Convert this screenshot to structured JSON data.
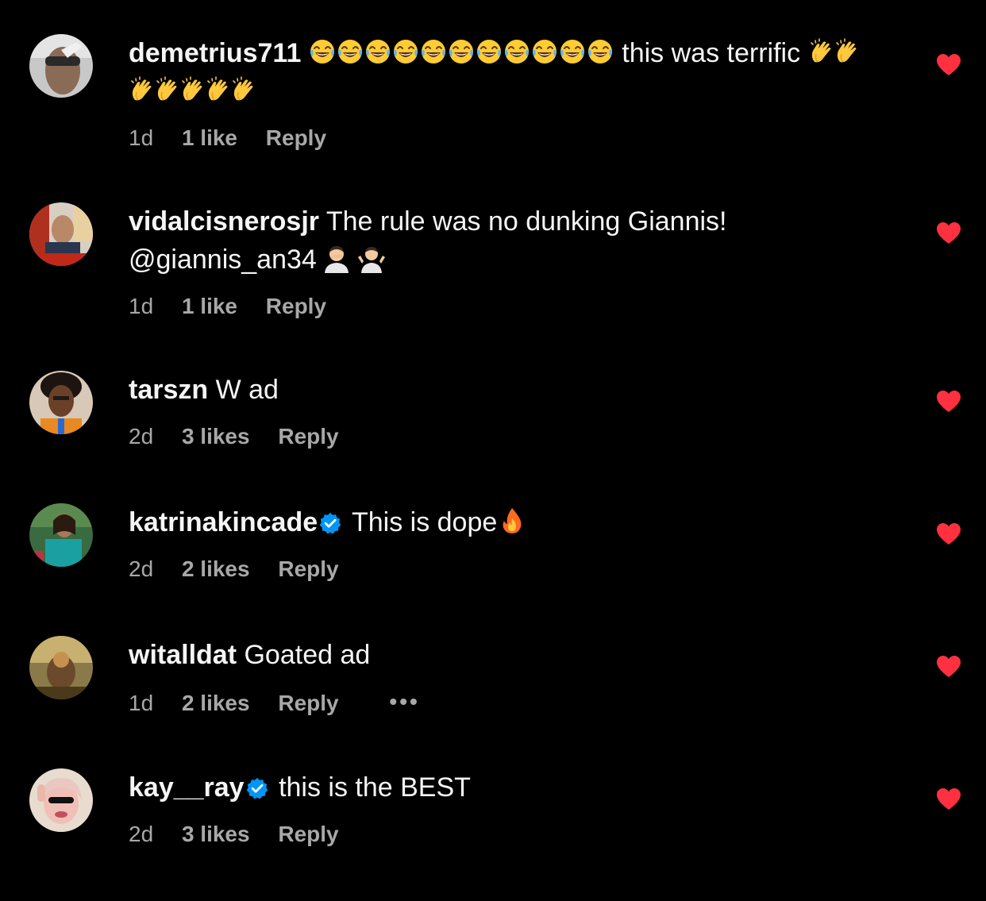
{
  "comments": [
    {
      "username": "demetrius711",
      "verified": false,
      "text_pre_emoji_count": 12,
      "text": "this was terrific",
      "time": "1d",
      "likes": "1 like",
      "reply": "Reply"
    },
    {
      "username": "vidalcisnerosjr",
      "verified": false,
      "text": "The rule was no dunking Giannis!",
      "mention": "@giannis_an34",
      "time": "1d",
      "likes": "1 like",
      "reply": "Reply"
    },
    {
      "username": "tarszn",
      "verified": false,
      "text": "W ad",
      "time": "2d",
      "likes": "3 likes",
      "reply": "Reply"
    },
    {
      "username": "katrinakincade",
      "verified": true,
      "text": "This is dope",
      "time": "2d",
      "likes": "2 likes",
      "reply": "Reply"
    },
    {
      "username": "witalldat",
      "verified": false,
      "text": "Goated ad",
      "time": "1d",
      "likes": "2 likes",
      "reply": "Reply",
      "more": "•••"
    },
    {
      "username": "kay__ray",
      "verified": true,
      "text": "this is the BEST",
      "time": "2d",
      "likes": "3 likes",
      "reply": "Reply"
    }
  ],
  "icons": {
    "heart": "heart-icon",
    "verified": "verified-badge-icon",
    "more": "more-options-icon"
  },
  "colors": {
    "background": "#000000",
    "text": "#f5f5f5",
    "muted": "#a8a8a8",
    "heart": "#ff3040",
    "verified": "#0095f6"
  }
}
